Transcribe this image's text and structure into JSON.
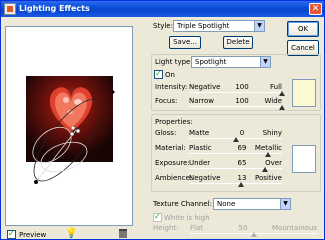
{
  "window": {
    "title": "Lighting Effects",
    "close_glyph": "✕"
  },
  "style": {
    "label": "Style:",
    "value": "Triple Spotlight",
    "save": "Save...",
    "delete": "Delete"
  },
  "buttons": {
    "ok": "OK",
    "cancel": "Cancel"
  },
  "light": {
    "type_label": "Light type:",
    "type_value": "Spotlight",
    "on_label": "On",
    "on_checked": true,
    "intensity": {
      "label": "Intensity:",
      "min": "Negative",
      "value": "100",
      "max": "Full",
      "fraction": 1.0
    },
    "focus": {
      "label": "Focus:",
      "min": "Narrow",
      "value": "100",
      "max": "Wide",
      "fraction": 1.0
    },
    "color": "#fdf7d2"
  },
  "properties": {
    "heading": "Properties:",
    "gloss": {
      "label": "Gloss:",
      "min": "Matte",
      "value": "0",
      "max": "Shiny",
      "fraction": 0.5
    },
    "material": {
      "label": "Material:",
      "min": "Plastic",
      "value": "69",
      "max": "Metallic",
      "fraction": 0.85
    },
    "exposure": {
      "label": "Exposure:",
      "min": "Under",
      "value": "65",
      "max": "Over",
      "fraction": 0.82
    },
    "ambience": {
      "label": "Ambience:",
      "min": "Negative",
      "value": "13",
      "max": "Positive",
      "fraction": 0.56
    },
    "color": "#ffffff"
  },
  "texture": {
    "label": "Texture Channel:",
    "value": "None",
    "white_is_high": "White is high",
    "height": {
      "label": "Height:",
      "min": "Flat",
      "value": "50",
      "max": "Mountainous",
      "fraction": 0.5
    }
  },
  "preview": {
    "label": "Preview",
    "checked": true,
    "bulb_glyph": "💡"
  }
}
